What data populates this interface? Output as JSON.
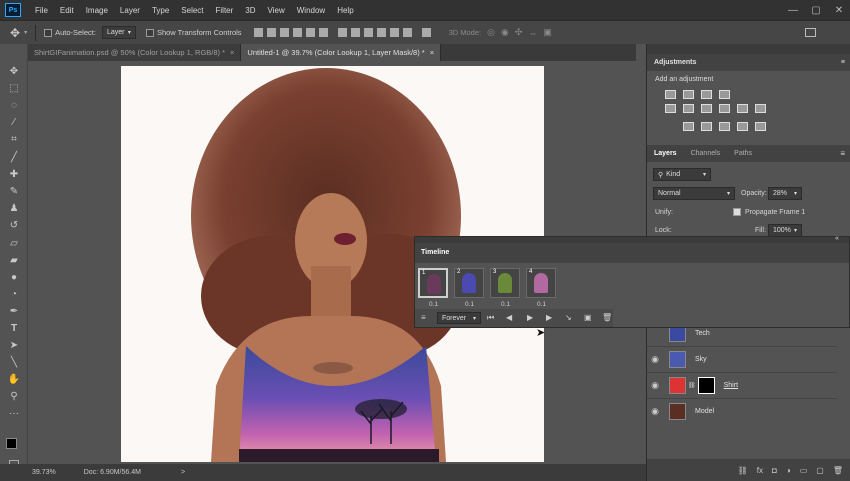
{
  "app": {
    "logo": "Ps"
  },
  "menu": [
    "File",
    "Edit",
    "Image",
    "Layer",
    "Type",
    "Select",
    "Filter",
    "3D",
    "View",
    "Window",
    "Help"
  ],
  "window_controls": {
    "minimize": "—",
    "maximize": "▢",
    "close": "✕"
  },
  "options_bar": {
    "auto_select_label": "Auto-Select:",
    "auto_select_value": "Layer",
    "transform_label": "Show Transform Controls",
    "mode_3d_label": "3D Mode:"
  },
  "tabs": [
    {
      "label": "ShirtGIFanimation.psd @ 50% (Color Lookup 1, RGB/8) *",
      "close": "×",
      "active": false
    },
    {
      "label": "Untitled-1 @ 39.7% (Color Lookup 1, Layer Mask/8) *",
      "close": "×",
      "active": true
    }
  ],
  "status": {
    "zoom": "39.73%",
    "doc": "Doc: 6.90M/56.4M",
    "arrow": ">"
  },
  "adjustments": {
    "title": "Adjustments",
    "subtitle": "Add an adjustment"
  },
  "layers_panel": {
    "tabs": [
      "Layers",
      "Channels",
      "Paths"
    ],
    "kind_label": "Kind",
    "blend_mode": "Normal",
    "opacity_label": "Opacity:",
    "opacity_value": "28%",
    "unify_label": "Unify:",
    "propagate_label": "Propagate Frame 1",
    "lock_label": "Lock:",
    "fill_label": "Fill:",
    "fill_value": "100%",
    "layers": [
      {
        "name": "Tech",
        "visible": false
      },
      {
        "name": "Sky",
        "visible": true
      },
      {
        "name": "Shirt",
        "visible": true
      },
      {
        "name": "Model",
        "visible": true
      }
    ]
  },
  "timeline": {
    "title": "Timeline",
    "frames": [
      {
        "number": "1",
        "delay": "0.1"
      },
      {
        "number": "2",
        "delay": "0.1"
      },
      {
        "number": "3",
        "delay": "0.1"
      },
      {
        "number": "4",
        "delay": "0.1"
      }
    ],
    "loop": "Forever"
  },
  "colors": {
    "menubar": "#323232",
    "panel": "#535353",
    "accent": "#31a8ff"
  }
}
